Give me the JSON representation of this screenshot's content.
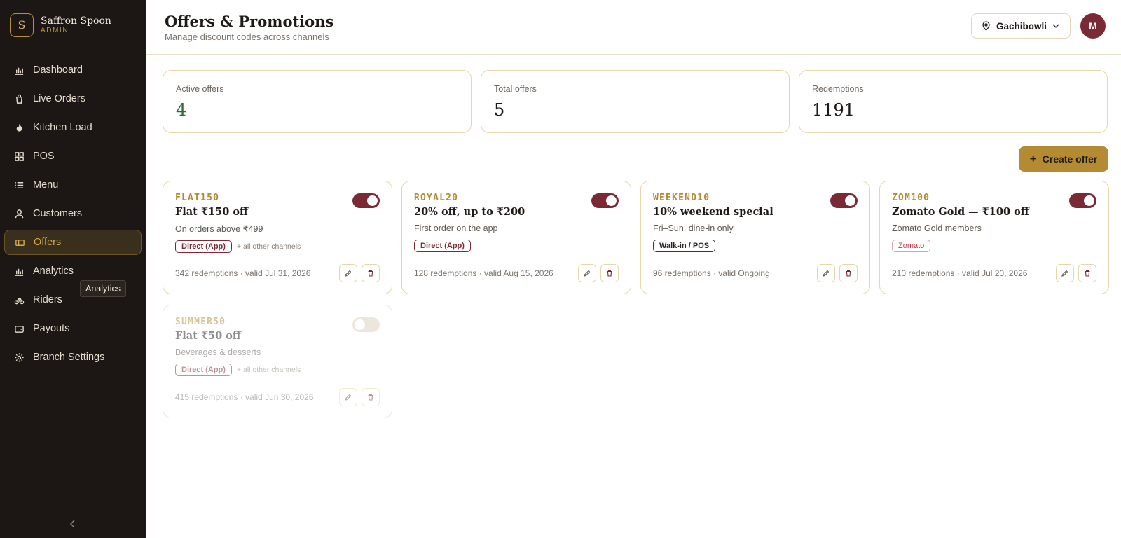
{
  "brand": {
    "initial": "S",
    "name": "Saffron Spoon",
    "sub": "ADMIN"
  },
  "nav": [
    {
      "label": "Dashboard",
      "icon": "bar-chart-icon"
    },
    {
      "label": "Live Orders",
      "icon": "shopping-bag-icon"
    },
    {
      "label": "Kitchen Load",
      "icon": "flame-icon"
    },
    {
      "label": "POS",
      "icon": "grid-icon"
    },
    {
      "label": "Menu",
      "icon": "list-icon"
    },
    {
      "label": "Customers",
      "icon": "user-icon"
    },
    {
      "label": "Offers",
      "icon": "ticket-icon",
      "active": true
    },
    {
      "label": "Analytics",
      "icon": "bar-chart-icon"
    },
    {
      "label": "Riders",
      "icon": "bike-icon"
    },
    {
      "label": "Payouts",
      "icon": "wallet-icon"
    },
    {
      "label": "Branch Settings",
      "icon": "gear-icon"
    }
  ],
  "tooltip": "Analytics",
  "header": {
    "title": "Offers & Promotions",
    "subtitle": "Manage discount codes across channels",
    "branch": "Gachibowli",
    "avatar": "M"
  },
  "stats": [
    {
      "label": "Active offers",
      "value": "4"
    },
    {
      "label": "Total offers",
      "value": "5"
    },
    {
      "label": "Redemptions",
      "value": "1191"
    }
  ],
  "create_button": "Create offer",
  "offers": [
    {
      "code": "FLAT150",
      "title": "Flat ₹150 off",
      "desc": "On orders above ₹499",
      "chip": "Direct (App)",
      "extra": "+ all other channels",
      "meta": "342 redemptions · valid Jul 31, 2026",
      "active": true
    },
    {
      "code": "ROYAL20",
      "title": "20% off, up to ₹200",
      "desc": "First order on the app",
      "chip": "Direct (App)",
      "extra": "",
      "meta": "128 redemptions · valid Aug 15, 2026",
      "active": true
    },
    {
      "code": "WEEKEND10",
      "title": "10% weekend special",
      "desc": "Fri–Sun, dine-in only",
      "chip": "Walk-in / POS",
      "extra": "",
      "meta": "96 redemptions · valid Ongoing",
      "active": true
    },
    {
      "code": "ZOM100",
      "title": "Zomato Gold — ₹100 off",
      "desc": "Zomato Gold members",
      "chip": "Zomato",
      "extra": "",
      "meta": "210 redemptions · valid Jul 20, 2026",
      "active": true
    },
    {
      "code": "SUMMER50",
      "title": "Flat ₹50 off",
      "desc": "Beverages & desserts",
      "chip": "Direct (App)",
      "extra": "+ all other channels",
      "meta": "415 redemptions · valid Jun 30, 2026",
      "active": false
    }
  ],
  "colors": {
    "accent": "#b48a32",
    "maroon": "#7a2a35",
    "sidebar": "#1c1714",
    "green": "#2e6b3a"
  }
}
